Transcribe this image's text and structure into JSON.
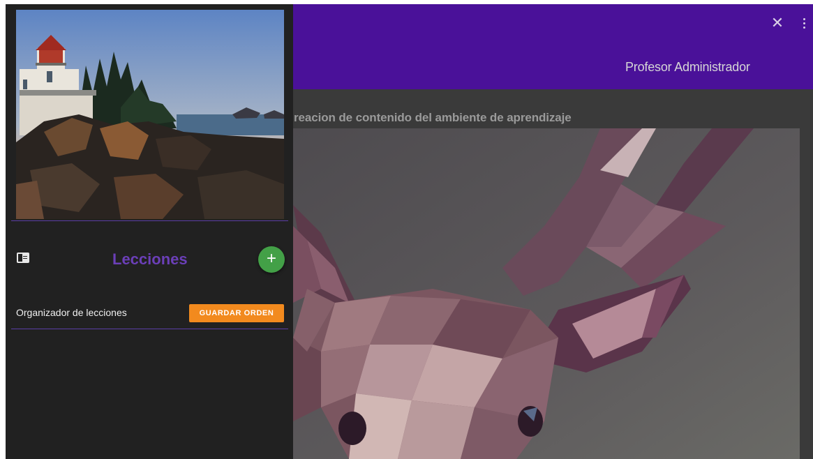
{
  "header": {
    "user_name": "Profesor Administrador",
    "close_icon": "close-icon",
    "more_icon": "more-vertical-icon"
  },
  "main": {
    "heading": "reacion de contenido del ambiente de aprendizaje",
    "hero_image": "low-poly-deer-illustration"
  },
  "drawer": {
    "cover_image": "lighthouse-on-rocky-coast-photo",
    "section_title": "Lecciones",
    "section_icon": "panel-icon",
    "add_label": "+",
    "organizer_label": "Organizador de lecciones",
    "save_order_label": "GUARDAR ORDEN"
  },
  "colors": {
    "appbar": "#4a1199",
    "accent_purple": "#6b3fb8",
    "add_green": "#43a047",
    "save_orange": "#f28a1e",
    "drawer_bg": "#212121"
  }
}
